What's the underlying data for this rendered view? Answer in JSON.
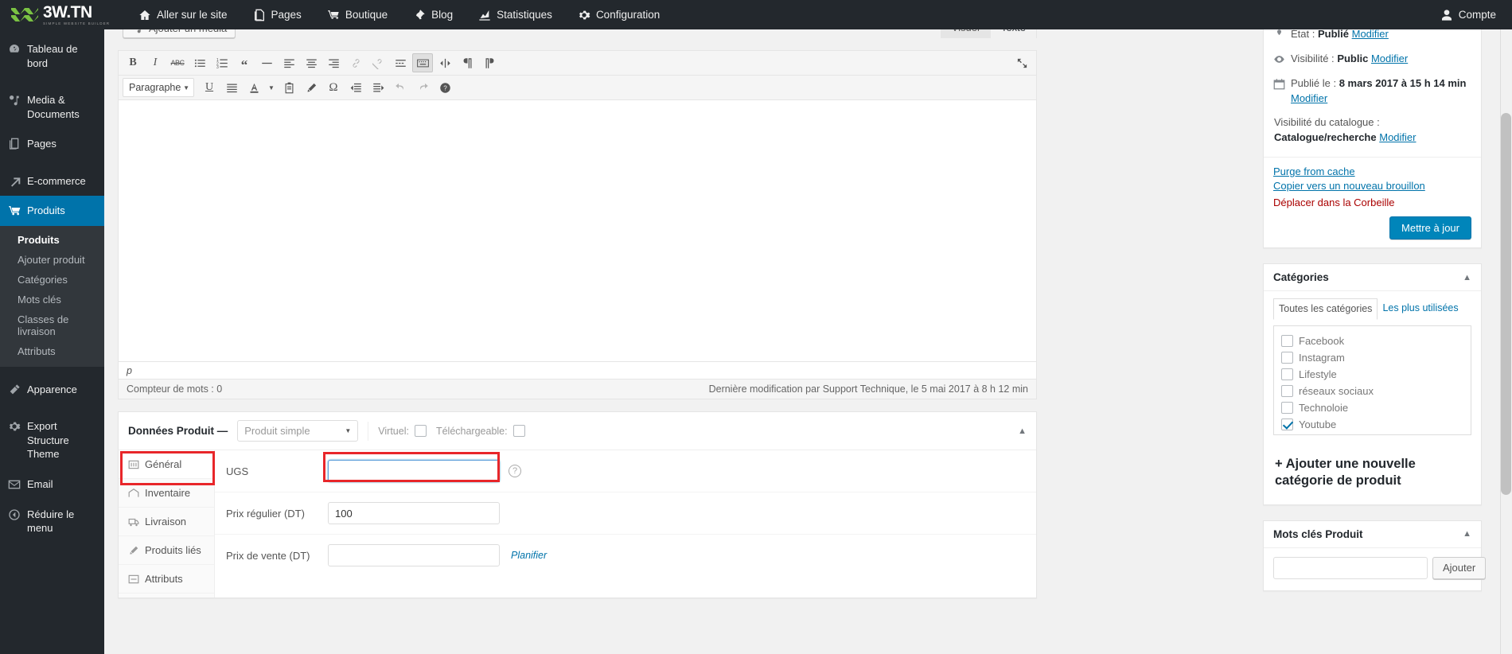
{
  "brand": {
    "name_main": "3W.TN",
    "tagline": "SIMPLE WEBSITE BUILDER"
  },
  "adminbar": {
    "items": [
      {
        "label": "Aller sur le site",
        "icon": "home-icon"
      },
      {
        "label": "Pages",
        "icon": "pages-icon"
      },
      {
        "label": "Boutique",
        "icon": "cart-icon"
      },
      {
        "label": "Blog",
        "icon": "pin-icon"
      },
      {
        "label": "Statistiques",
        "icon": "chart-icon"
      },
      {
        "label": "Configuration",
        "icon": "gear-icon"
      }
    ],
    "account_label": "Compte",
    "account_icon": "user-icon"
  },
  "sidebar": {
    "items": [
      {
        "label": "Tableau de bord",
        "icon": "dashboard-icon"
      },
      {
        "label": "Media & Documents",
        "icon": "media-icon"
      },
      {
        "label": "Pages",
        "icon": "pages-icon"
      },
      {
        "label": "E-commerce",
        "icon": "arrow-icon"
      },
      {
        "label": "Produits",
        "icon": "cart-icon",
        "active": true
      }
    ],
    "submenu": [
      {
        "label": "Produits",
        "current": true
      },
      {
        "label": "Ajouter produit"
      },
      {
        "label": "Catégories"
      },
      {
        "label": "Mots clés"
      },
      {
        "label": "Classes de livraison"
      },
      {
        "label": "Attributs"
      }
    ],
    "bottom_items": [
      {
        "label": "Apparence",
        "icon": "brush-icon"
      },
      {
        "label": "Export Structure Theme",
        "icon": "gear-icon"
      },
      {
        "label": "Email",
        "icon": "mail-icon"
      },
      {
        "label": "Réduire le menu",
        "icon": "collapse-icon"
      }
    ]
  },
  "editor": {
    "add_media_label": "Ajouter un média",
    "tabs": [
      {
        "label": "Visuel",
        "active": false
      },
      {
        "label": "Texte",
        "active": true
      }
    ],
    "paragraph_select": "Paragraphe",
    "toolbar_row1": [
      "bold-icon",
      "italic-icon",
      "strikethrough-icon",
      "bullet-list-icon",
      "numbered-list-icon",
      "blockquote-icon",
      "horizontal-rule-icon",
      "align-left-icon",
      "align-center-icon",
      "align-right-icon",
      "link-icon",
      "unlink-icon",
      "read-more-icon",
      "keyboard-icon",
      "fullscreen-toggle-icon",
      "paragraph-ltr-icon",
      "paragraph-rtl-icon"
    ],
    "toolbar_row2": [
      "underline-icon",
      "justify-icon",
      "text-color-icon",
      "paste-text-icon",
      "clear-formatting-icon",
      "special-character-icon",
      "outdent-icon",
      "indent-icon",
      "undo-icon",
      "redo-icon",
      "help-icon"
    ],
    "path": "p",
    "word_count": "Compteur de mots : 0",
    "last_modified": "Dernière modification par Support Technique, le 5 mai 2017 à 8 h 12 min"
  },
  "product_data": {
    "title": "Données Produit —",
    "type_select": "Produit simple",
    "virtual_label": "Virtuel:",
    "downloadable_label": "Téléchargeable:",
    "tabs": [
      {
        "label": "Général",
        "icon": "general-icon",
        "active": true,
        "highlighted": true
      },
      {
        "label": "Inventaire",
        "icon": "inventory-icon"
      },
      {
        "label": "Livraison",
        "icon": "shipping-icon"
      },
      {
        "label": "Produits liés",
        "icon": "linked-products-icon"
      },
      {
        "label": "Attributs",
        "icon": "attributes-icon"
      }
    ],
    "fields": {
      "sku_label": "UGS",
      "sku_value": "",
      "regular_price_label": "Prix régulier (DT)",
      "regular_price_value": "100",
      "sale_price_label": "Prix de vente (DT)",
      "sale_price_value": "",
      "schedule_link": "Planifier"
    }
  },
  "publish_box": {
    "status_label": "État :",
    "status_value": "Publié",
    "status_edit": "Modifier",
    "visibility_label": "Visibilité :",
    "visibility_value": "Public",
    "visibility_edit": "Modifier",
    "published_label": "Publié le :",
    "published_value": "8 mars 2017 à 15 h 14 min",
    "published_edit": "Modifier",
    "catalog_label": "Visibilité du catalogue :",
    "catalog_value": "Catalogue/recherche",
    "catalog_edit": "Modifier",
    "purge_cache": "Purge from cache",
    "copy_draft": "Copier vers un nouveau brouillon",
    "trash": "Déplacer dans la Corbeille",
    "update_button": "Mettre à jour"
  },
  "categories_box": {
    "title": "Catégories",
    "tab_all": "Toutes les catégories",
    "tab_most_used": "Les plus utilisées",
    "items": [
      {
        "label": "Facebook",
        "checked": false
      },
      {
        "label": "Instagram",
        "checked": false
      },
      {
        "label": "Lifestyle",
        "checked": false
      },
      {
        "label": "réseaux sociaux",
        "checked": false
      },
      {
        "label": "Technoloie",
        "checked": false
      },
      {
        "label": "Youtube",
        "checked": true
      }
    ],
    "add_new": "+ Ajouter une nouvelle catégorie de produit"
  },
  "tags_box": {
    "title": "Mots clés Produit",
    "input_value": "",
    "add_button": "Ajouter"
  },
  "colors": {
    "admin_dark": "#23282d",
    "accent_blue": "#0073aa",
    "highlight_red": "#e8262a",
    "logo_green": "#7ac143"
  }
}
